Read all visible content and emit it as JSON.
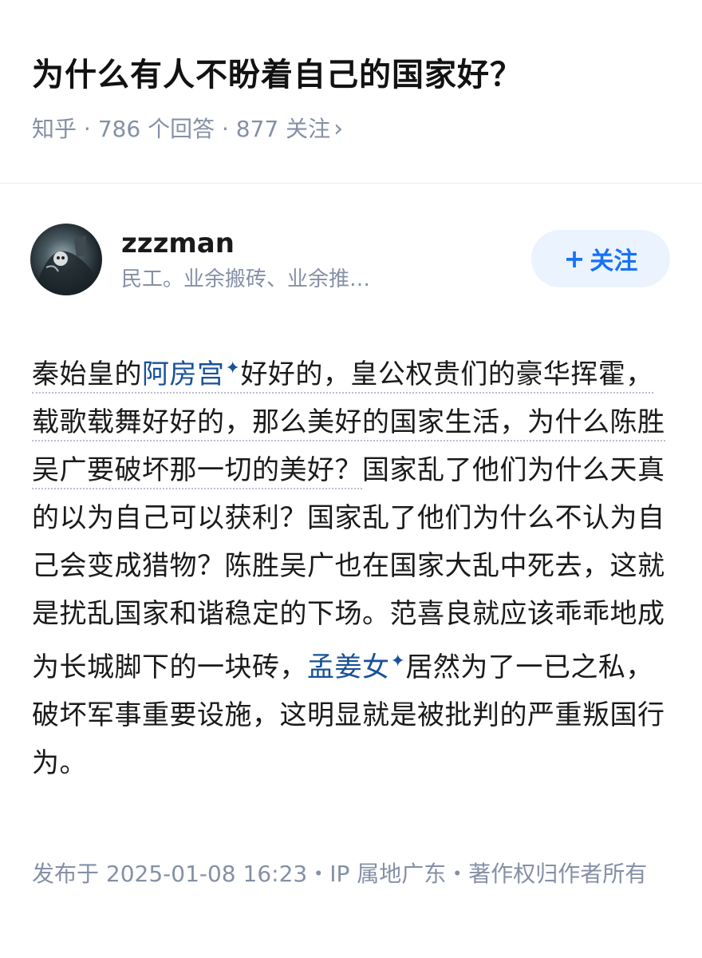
{
  "question": {
    "title": "为什么有人不盼着自己的国家好？",
    "source": "知乎",
    "answers": "786 个回答",
    "followers": "877 关注",
    "separator": " · ",
    "chevron": "›"
  },
  "author": {
    "name": "zzzman",
    "bio": "民工。业余搬砖、业余推…",
    "follow_plus": "+",
    "follow_label": "关注"
  },
  "answer": {
    "seg1_underlined": "秦始皇的",
    "keyword1": "阿房宫",
    "seg2_underlined": "好好的，皇公权贵们的豪华挥霍，载歌载舞好好的，那么美好的国家生活，为什么陈胜吴广要破坏那一切的美好？",
    "seg3": "国家乱了他们为什么天真的以为自己可以获利？国家乱了他们为什么不认为自己会变成猎物？陈胜吴广也在国家大乱中死去，这就是扰乱国家和谐稳定的下场。范喜良就应该乖乖地成为长城脚下的一块砖，",
    "keyword2": "孟姜女",
    "seg4": "居然为了一已之私，破坏军事重要设施，这明显就是被批判的严重叛国行为。",
    "spark": "✦"
  },
  "footer": {
    "meta": "发布于 2025-01-08 16:23・IP 属地广东・著作权归作者所有"
  }
}
